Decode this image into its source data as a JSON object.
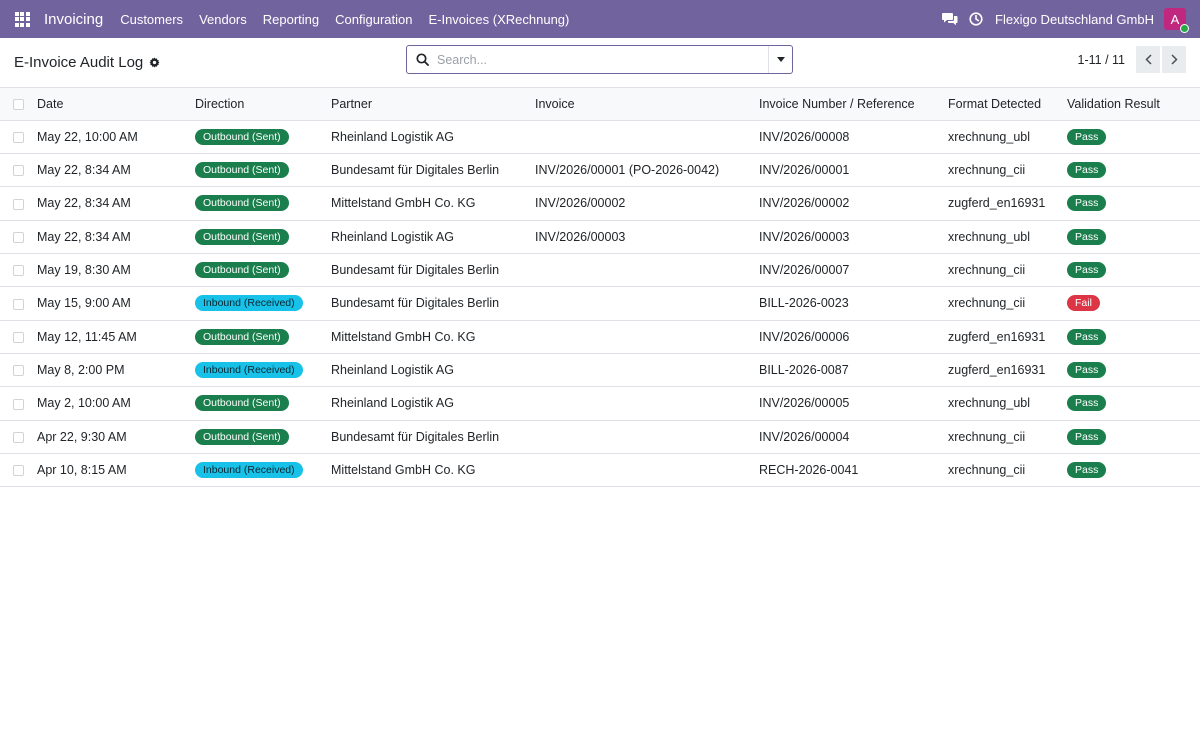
{
  "navbar": {
    "brand": "Invoicing",
    "menu": [
      "Customers",
      "Vendors",
      "Reporting",
      "Configuration",
      "E-Invoices (XRechnung)"
    ],
    "company": "Flexigo Deutschland GmbH",
    "avatar_letter": "A",
    "icons": [
      "apps-grid-icon",
      "chat-icon",
      "clock-icon"
    ],
    "colors": {
      "bar": "#71639e",
      "avatar": "#c0277e"
    }
  },
  "control": {
    "title": "E-Invoice Audit Log",
    "search_placeholder": "Search...",
    "pager": "1-11 / 11"
  },
  "table": {
    "headers": [
      "Date",
      "Direction",
      "Partner",
      "Invoice",
      "Invoice Number / Reference",
      "Format Detected",
      "Validation Result"
    ],
    "rows": [
      {
        "date": "May 22, 10:00 AM",
        "direction": "Outbound (Sent)",
        "dir_type": "outbound",
        "partner": "Rheinland Logistik AG",
        "invoice": "",
        "reference": "INV/2026/00008",
        "format": "xrechnung_ubl",
        "result": "Pass",
        "result_type": "pass"
      },
      {
        "date": "May 22, 8:34 AM",
        "direction": "Outbound (Sent)",
        "dir_type": "outbound",
        "partner": "Bundesamt für Digitales Berlin",
        "invoice": "INV/2026/00001 (PO-2026-0042)",
        "reference": "INV/2026/00001",
        "format": "xrechnung_cii",
        "result": "Pass",
        "result_type": "pass"
      },
      {
        "date": "May 22, 8:34 AM",
        "direction": "Outbound (Sent)",
        "dir_type": "outbound",
        "partner": "Mittelstand GmbH Co. KG",
        "invoice": "INV/2026/00002",
        "reference": "INV/2026/00002",
        "format": "zugferd_en16931",
        "result": "Pass",
        "result_type": "pass"
      },
      {
        "date": "May 22, 8:34 AM",
        "direction": "Outbound (Sent)",
        "dir_type": "outbound",
        "partner": "Rheinland Logistik AG",
        "invoice": "INV/2026/00003",
        "reference": "INV/2026/00003",
        "format": "xrechnung_ubl",
        "result": "Pass",
        "result_type": "pass"
      },
      {
        "date": "May 19, 8:30 AM",
        "direction": "Outbound (Sent)",
        "dir_type": "outbound",
        "partner": "Bundesamt für Digitales Berlin",
        "invoice": "",
        "reference": "INV/2026/00007",
        "format": "xrechnung_cii",
        "result": "Pass",
        "result_type": "pass"
      },
      {
        "date": "May 15, 9:00 AM",
        "direction": "Inbound (Received)",
        "dir_type": "inbound",
        "partner": "Bundesamt für Digitales Berlin",
        "invoice": "",
        "reference": "BILL-2026-0023",
        "format": "xrechnung_cii",
        "result": "Fail",
        "result_type": "fail"
      },
      {
        "date": "May 12, 11:45 AM",
        "direction": "Outbound (Sent)",
        "dir_type": "outbound",
        "partner": "Mittelstand GmbH Co. KG",
        "invoice": "",
        "reference": "INV/2026/00006",
        "format": "zugferd_en16931",
        "result": "Pass",
        "result_type": "pass"
      },
      {
        "date": "May 8, 2:00 PM",
        "direction": "Inbound (Received)",
        "dir_type": "inbound",
        "partner": "Rheinland Logistik AG",
        "invoice": "",
        "reference": "BILL-2026-0087",
        "format": "zugferd_en16931",
        "result": "Pass",
        "result_type": "pass"
      },
      {
        "date": "May 2, 10:00 AM",
        "direction": "Outbound (Sent)",
        "dir_type": "outbound",
        "partner": "Rheinland Logistik AG",
        "invoice": "",
        "reference": "INV/2026/00005",
        "format": "xrechnung_ubl",
        "result": "Pass",
        "result_type": "pass"
      },
      {
        "date": "Apr 22, 9:30 AM",
        "direction": "Outbound (Sent)",
        "dir_type": "outbound",
        "partner": "Bundesamt für Digitales Berlin",
        "invoice": "",
        "reference": "INV/2026/00004",
        "format": "xrechnung_cii",
        "result": "Pass",
        "result_type": "pass"
      },
      {
        "date": "Apr 10, 8:15 AM",
        "direction": "Inbound (Received)",
        "dir_type": "inbound",
        "partner": "Mittelstand GmbH Co. KG",
        "invoice": "",
        "reference": "RECH-2026-0041",
        "format": "xrechnung_cii",
        "result": "Pass",
        "result_type": "pass"
      }
    ]
  }
}
